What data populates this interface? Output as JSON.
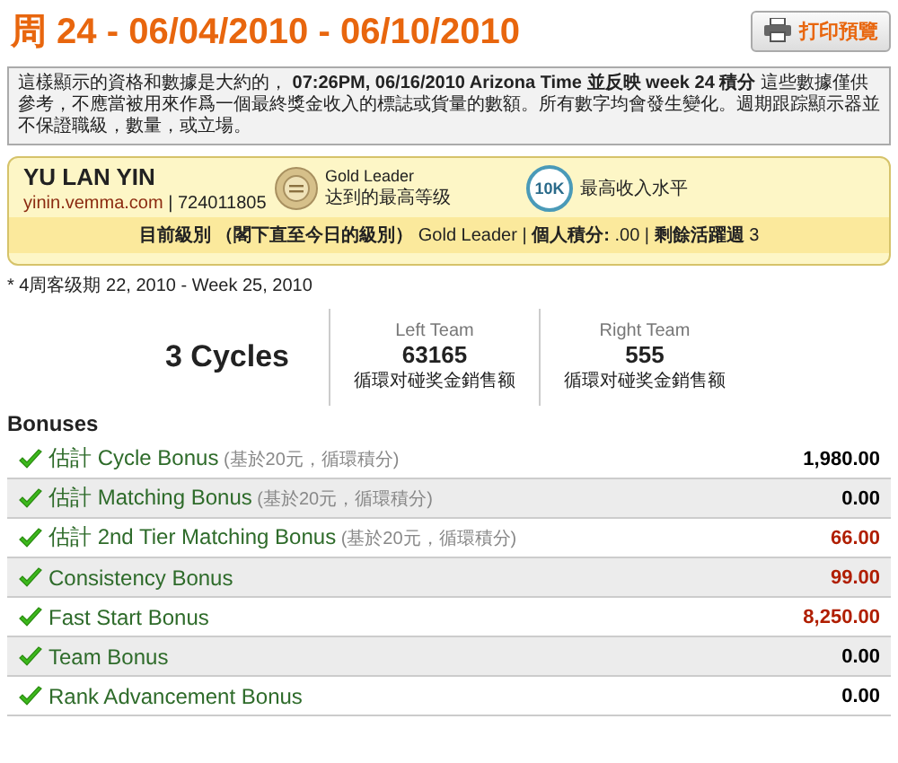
{
  "header": {
    "title": "周 24 - 06/04/2010 - 06/10/2010",
    "print_button": "打印預覽"
  },
  "notice": "這樣顯示的資格和數據是大約的， **07:26PM, 06/16/2010 Arizona Time 並反映 week 24 積分** 這些數據僅供參考，不應當被用來作爲一個最終獎金收入的標誌或貨量的數額。所有數字均會發生變化。週期跟踪顯示器並不保證職級，數量，或立場。",
  "member": {
    "name": "YU LAN YIN",
    "site": "yinin.vemma.com",
    "id": "| 724011805",
    "badges": [
      {
        "kind": "medal",
        "title": "Gold Leader",
        "caption": "达到的最高等级"
      },
      {
        "kind": "wreath",
        "icon_text": "10K",
        "caption": "最高收入水平"
      }
    ],
    "status": "**目前級別 （閣下直至今日的級別）** Gold Leader | **個人積分:** .00 | **剩餘活躍週** 3"
  },
  "period_note": "* 4周客级期 22, 2010 - Week 25, 2010",
  "cycles": {
    "total": "3 Cycles",
    "teams": [
      {
        "label": "Left Team",
        "value": "63165",
        "caption": "循環对碰奖金銷售额"
      },
      {
        "label": "Right Team",
        "value": "555",
        "caption": "循環对碰奖金銷售额"
      }
    ]
  },
  "bonuses": {
    "title": "Bonuses",
    "rows": [
      {
        "prefix": "估計",
        "name": "Cycle Bonus",
        "note": "(基於20元，循環積分)",
        "amount": "1,980.00",
        "color": "#000000"
      },
      {
        "prefix": "估計",
        "name": "Matching Bonus",
        "note": "(基於20元，循環積分)",
        "amount": "0.00",
        "color": "#000000"
      },
      {
        "prefix": "估計",
        "name": "2nd Tier Matching Bonus",
        "note": "(基於20元，循環積分)",
        "amount": "66.00",
        "color": "#b01e00"
      },
      {
        "name": "Consistency Bonus",
        "amount": "99.00",
        "color": "#b01e00"
      },
      {
        "name": "Fast Start Bonus",
        "amount": "8,250.00",
        "color": "#b01e00"
      },
      {
        "name": "Team Bonus",
        "amount": "0.00",
        "color": "#000000"
      },
      {
        "name": "Rank Advancement Bonus",
        "amount": "0.00",
        "color": "#000000"
      }
    ]
  }
}
